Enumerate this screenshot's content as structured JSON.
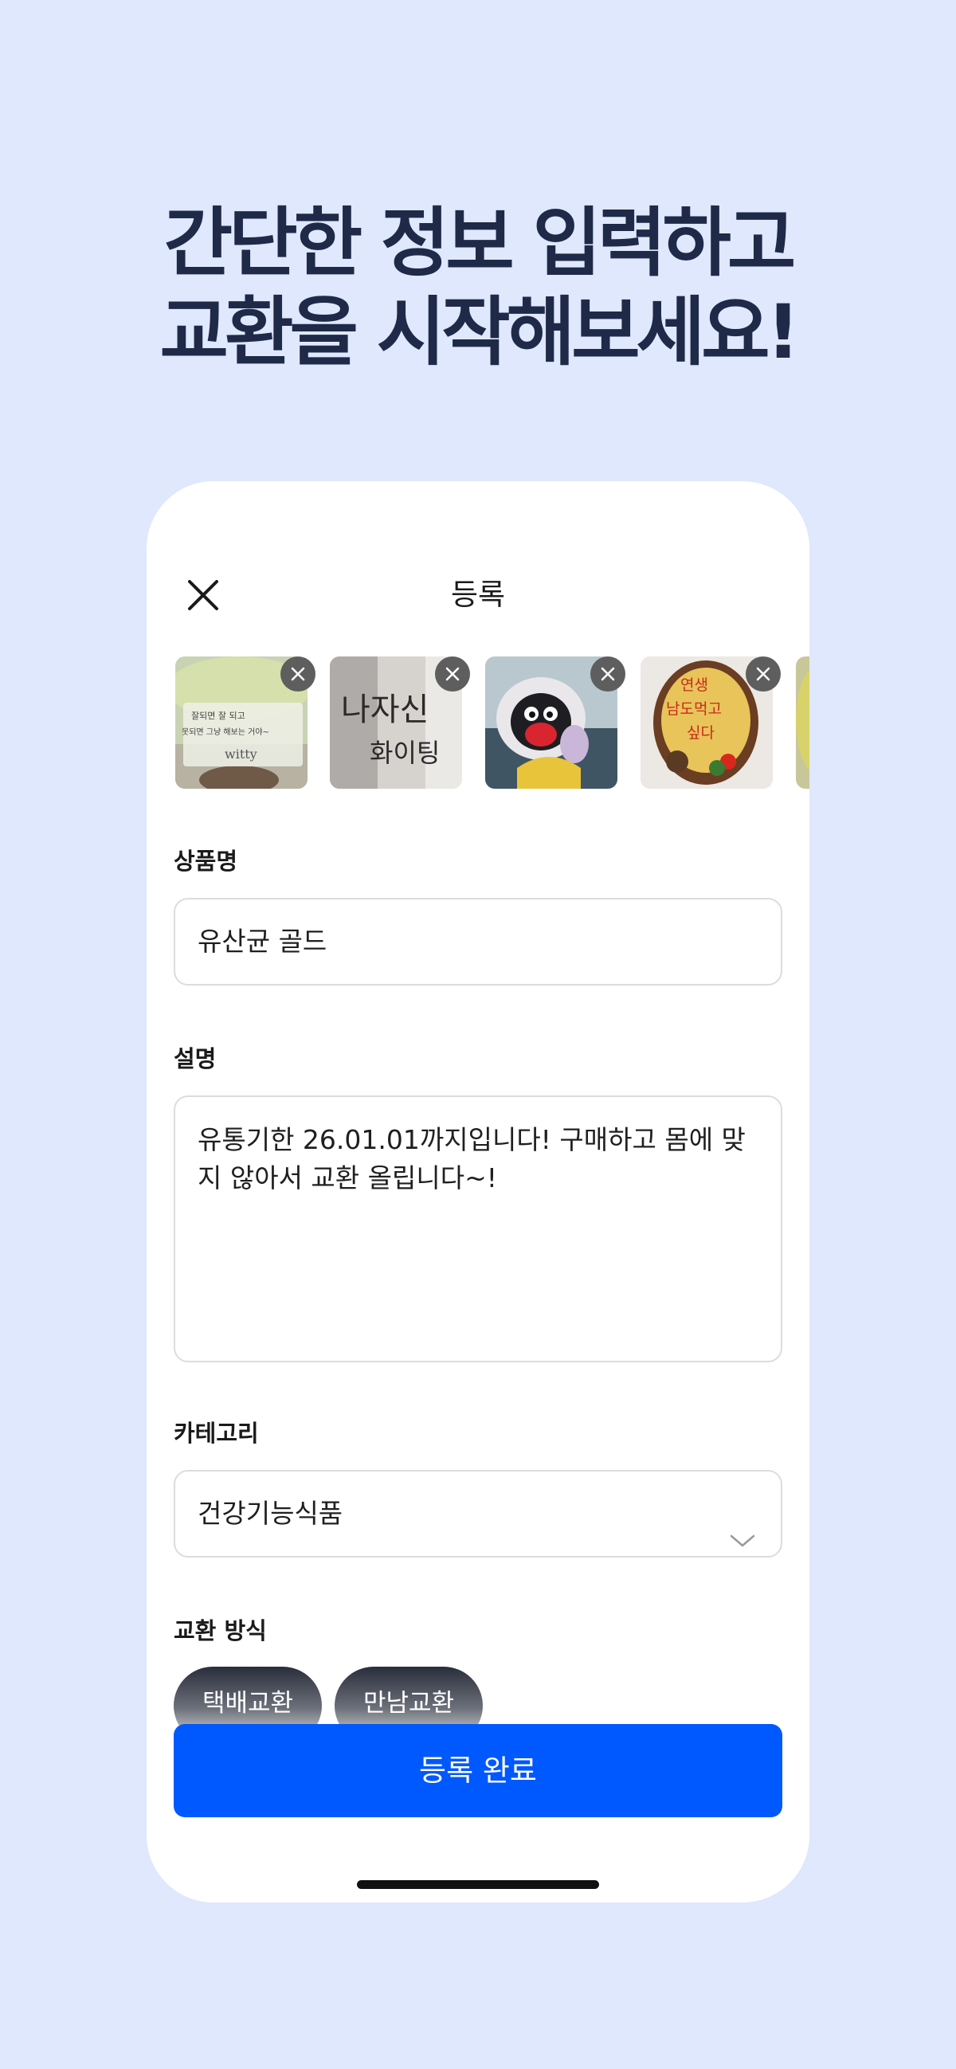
{
  "headline": {
    "line1": "간단한 정보 입력하고",
    "line2": "교환을 시작해보세요!"
  },
  "screen": {
    "title": "등록",
    "close_icon": "close-icon",
    "photos": [
      {
        "name": "photo-sticky-note",
        "text_top": "잘되면 잘 되고",
        "text_mid": "못되면 그냥 해보는 거야~",
        "text_brand": "witty"
      },
      {
        "name": "photo-handwritten",
        "text_top": "나자신",
        "text_bottom": "화이팅"
      },
      {
        "name": "photo-penguin"
      },
      {
        "name": "photo-lunchbox",
        "text_top": "연생",
        "text_mid": "남도먹고",
        "text_bottom": "싶다"
      },
      {
        "name": "photo-partial"
      }
    ],
    "product_name": {
      "label": "상품명",
      "value": "유산균 골드"
    },
    "description": {
      "label": "설명",
      "value": "유통기한 26.01.01까지입니다! 구매하고 몸에 맞지 않아서 교환 올립니다~!"
    },
    "category": {
      "label": "카테고리",
      "value": "건강기능식품"
    },
    "exchange": {
      "label": "교환 방식",
      "options": [
        "택배교환",
        "만남교환"
      ]
    },
    "submit_label": "등록 완료"
  },
  "colors": {
    "background": "#dfe8fc",
    "headline": "#1e2a48",
    "primary": "#0058ff",
    "chip": "#1f2433"
  }
}
